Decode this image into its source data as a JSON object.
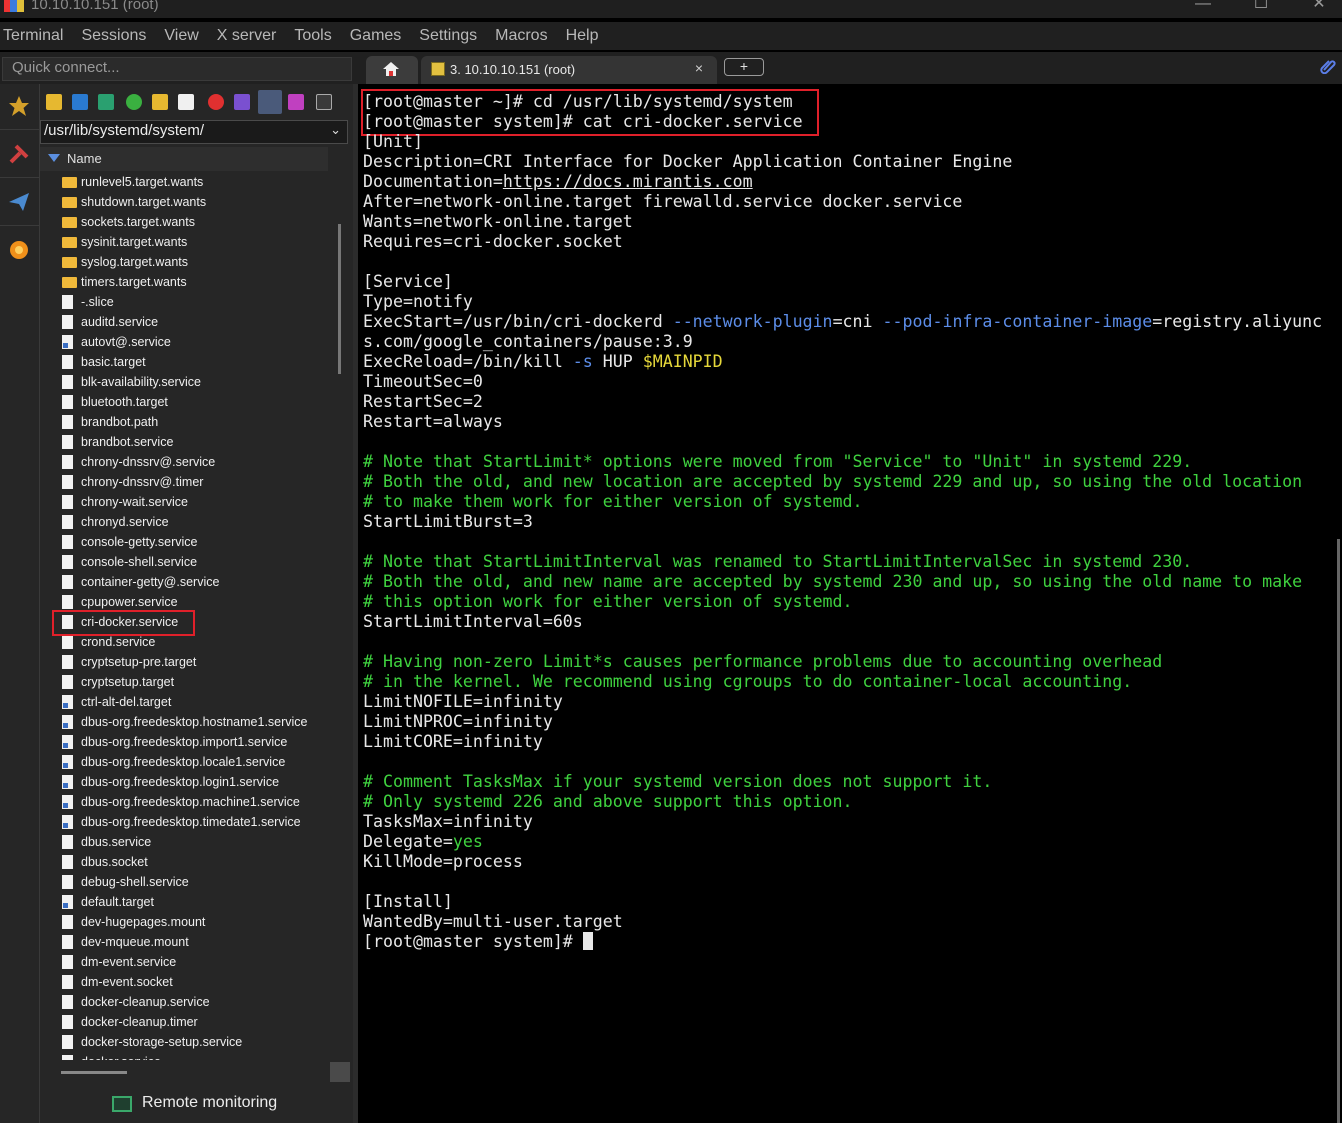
{
  "window": {
    "title": "10.10.10.151 (root)"
  },
  "menu": [
    "Terminal",
    "Sessions",
    "View",
    "X server",
    "Tools",
    "Games",
    "Settings",
    "Macros",
    "Help"
  ],
  "quick_connect": {
    "placeholder": "Quick connect..."
  },
  "tabs": {
    "session_label": "3. 10.10.10.151 (root)",
    "close": "×",
    "add": "+"
  },
  "sftp": {
    "path": "/usr/lib/systemd/system/",
    "column": "Name",
    "files": [
      {
        "name": "runlevel5.target.wants",
        "type": "folder"
      },
      {
        "name": "shutdown.target.wants",
        "type": "folder"
      },
      {
        "name": "sockets.target.wants",
        "type": "folder"
      },
      {
        "name": "sysinit.target.wants",
        "type": "folder"
      },
      {
        "name": "syslog.target.wants",
        "type": "folder"
      },
      {
        "name": "timers.target.wants",
        "type": "folder"
      },
      {
        "name": "-.slice",
        "type": "file"
      },
      {
        "name": "auditd.service",
        "type": "file"
      },
      {
        "name": "autovt@.service",
        "type": "link"
      },
      {
        "name": "basic.target",
        "type": "file"
      },
      {
        "name": "blk-availability.service",
        "type": "file"
      },
      {
        "name": "bluetooth.target",
        "type": "file"
      },
      {
        "name": "brandbot.path",
        "type": "file"
      },
      {
        "name": "brandbot.service",
        "type": "file"
      },
      {
        "name": "chrony-dnssrv@.service",
        "type": "file"
      },
      {
        "name": "chrony-dnssrv@.timer",
        "type": "file"
      },
      {
        "name": "chrony-wait.service",
        "type": "file"
      },
      {
        "name": "chronyd.service",
        "type": "file"
      },
      {
        "name": "console-getty.service",
        "type": "file"
      },
      {
        "name": "console-shell.service",
        "type": "file"
      },
      {
        "name": "container-getty@.service",
        "type": "file"
      },
      {
        "name": "cpupower.service",
        "type": "file"
      },
      {
        "name": "cri-docker.service",
        "type": "file"
      },
      {
        "name": "crond.service",
        "type": "file"
      },
      {
        "name": "cryptsetup-pre.target",
        "type": "file"
      },
      {
        "name": "cryptsetup.target",
        "type": "file"
      },
      {
        "name": "ctrl-alt-del.target",
        "type": "link"
      },
      {
        "name": "dbus-org.freedesktop.hostname1.service",
        "type": "link"
      },
      {
        "name": "dbus-org.freedesktop.import1.service",
        "type": "link"
      },
      {
        "name": "dbus-org.freedesktop.locale1.service",
        "type": "link"
      },
      {
        "name": "dbus-org.freedesktop.login1.service",
        "type": "link"
      },
      {
        "name": "dbus-org.freedesktop.machine1.service",
        "type": "link"
      },
      {
        "name": "dbus-org.freedesktop.timedate1.service",
        "type": "link"
      },
      {
        "name": "dbus.service",
        "type": "file"
      },
      {
        "name": "dbus.socket",
        "type": "file"
      },
      {
        "name": "debug-shell.service",
        "type": "file"
      },
      {
        "name": "default.target",
        "type": "link"
      },
      {
        "name": "dev-hugepages.mount",
        "type": "file"
      },
      {
        "name": "dev-mqueue.mount",
        "type": "file"
      },
      {
        "name": "dm-event.service",
        "type": "file"
      },
      {
        "name": "dm-event.socket",
        "type": "file"
      },
      {
        "name": "docker-cleanup.service",
        "type": "file"
      },
      {
        "name": "docker-cleanup.timer",
        "type": "file"
      },
      {
        "name": "docker-storage-setup.service",
        "type": "file"
      },
      {
        "name": "docker.service",
        "type": "file"
      }
    ],
    "remote_monitoring": "Remote monitoring"
  },
  "terminal": {
    "lines": [
      [
        {
          "t": "[root@master ~]# cd /usr/lib/systemd/system"
        }
      ],
      [
        {
          "t": "[root@master system]# cat cri-docker.service"
        }
      ],
      [
        {
          "t": "[Unit]"
        }
      ],
      [
        {
          "t": "Description=CRI Interface for Docker Application Container Engine"
        }
      ],
      [
        {
          "t": "Documentation="
        },
        {
          "t": "https://docs.mirantis.com",
          "c": "ul"
        }
      ],
      [
        {
          "t": "After=network-online.target firewalld.service docker.service"
        }
      ],
      [
        {
          "t": "Wants=network-online.target"
        }
      ],
      [
        {
          "t": "Requires=cri-docker.socket"
        }
      ],
      [
        {
          "t": ""
        }
      ],
      [
        {
          "t": "[Service]"
        }
      ],
      [
        {
          "t": "Type=notify"
        }
      ],
      [
        {
          "t": "ExecStart=/usr/bin/cri-dockerd "
        },
        {
          "t": "--network-plugin",
          "c": "bl"
        },
        {
          "t": "=cni "
        },
        {
          "t": "--pod-infra-container-image",
          "c": "bl"
        },
        {
          "t": "=registry.aliyunc"
        }
      ],
      [
        {
          "t": "s.com/google_containers/pause:3.9"
        }
      ],
      [
        {
          "t": "ExecReload=/bin/kill "
        },
        {
          "t": "-s",
          "c": "bl"
        },
        {
          "t": " HUP "
        },
        {
          "t": "$MAINPID",
          "c": "yl"
        }
      ],
      [
        {
          "t": "TimeoutSec=0"
        }
      ],
      [
        {
          "t": "RestartSec=2"
        }
      ],
      [
        {
          "t": "Restart=always"
        }
      ],
      [
        {
          "t": ""
        }
      ],
      [
        {
          "t": "# Note that StartLimit* options were moved from \"Service\" to \"Unit\" in systemd 229.",
          "c": "cm"
        }
      ],
      [
        {
          "t": "# Both the old, and new location are accepted by systemd 229 and up, so using the old location",
          "c": "cm"
        }
      ],
      [
        {
          "t": "# to make them work for either version of systemd.",
          "c": "cm"
        }
      ],
      [
        {
          "t": "StartLimitBurst=3"
        }
      ],
      [
        {
          "t": ""
        }
      ],
      [
        {
          "t": "# Note that StartLimitInterval was renamed to StartLimitIntervalSec in systemd 230.",
          "c": "cm"
        }
      ],
      [
        {
          "t": "# Both the old, and new name are accepted by systemd 230 and up, so using the old name to make",
          "c": "cm"
        }
      ],
      [
        {
          "t": "# this option work for either version of systemd.",
          "c": "cm"
        }
      ],
      [
        {
          "t": "StartLimitInterval=60s"
        }
      ],
      [
        {
          "t": ""
        }
      ],
      [
        {
          "t": "# Having non-zero Limit*s causes performance problems due to accounting overhead",
          "c": "cm"
        }
      ],
      [
        {
          "t": "# in the kernel. We recommend using cgroups to do container-local accounting.",
          "c": "cm"
        }
      ],
      [
        {
          "t": "LimitNOFILE=infinity"
        }
      ],
      [
        {
          "t": "LimitNPROC=infinity"
        }
      ],
      [
        {
          "t": "LimitCORE=infinity"
        }
      ],
      [
        {
          "t": ""
        }
      ],
      [
        {
          "t": "# Comment TasksMax if your systemd version does not support it.",
          "c": "cm"
        }
      ],
      [
        {
          "t": "# Only systemd 226 and above support this option.",
          "c": "cm"
        }
      ],
      [
        {
          "t": "TasksMax=infinity"
        }
      ],
      [
        {
          "t": "Delegate="
        },
        {
          "t": "yes",
          "c": "gr"
        }
      ],
      [
        {
          "t": "KillMode=process"
        }
      ],
      [
        {
          "t": ""
        }
      ],
      [
        {
          "t": "[Install]"
        }
      ],
      [
        {
          "t": "WantedBy=multi-user.target"
        }
      ],
      [
        {
          "t": "[root@master system]# "
        },
        {
          "t": "",
          "c": "cursor"
        }
      ]
    ]
  }
}
